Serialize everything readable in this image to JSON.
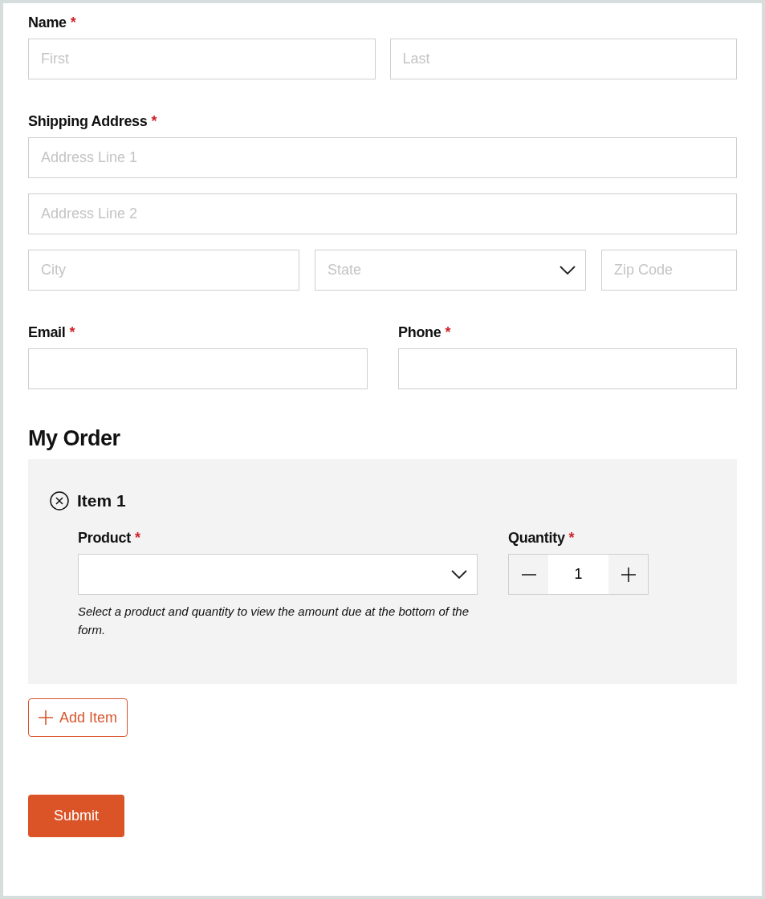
{
  "name_field": {
    "label": "Name",
    "required_mark": "*",
    "first": {
      "placeholder": "First"
    },
    "last": {
      "placeholder": "Last"
    }
  },
  "shipping_address": {
    "label": "Shipping Address",
    "required_mark": "*",
    "line1": {
      "placeholder": "Address Line 1"
    },
    "line2": {
      "placeholder": "Address Line 2"
    },
    "city": {
      "placeholder": "City"
    },
    "state": {
      "placeholder": "State"
    },
    "zip": {
      "placeholder": "Zip Code"
    }
  },
  "email": {
    "label": "Email",
    "required_mark": "*"
  },
  "phone": {
    "label": "Phone",
    "required_mark": "*"
  },
  "order": {
    "title": "My Order",
    "items": [
      {
        "title": "Item 1",
        "product": {
          "label": "Product",
          "required_mark": "*"
        },
        "helper": "Select a product and quantity to view the amount due at the bottom of the form.",
        "quantity": {
          "label": "Quantity",
          "required_mark": "*",
          "value": "1"
        }
      }
    ],
    "add_button": "Add Item"
  },
  "submit_button": "Submit"
}
